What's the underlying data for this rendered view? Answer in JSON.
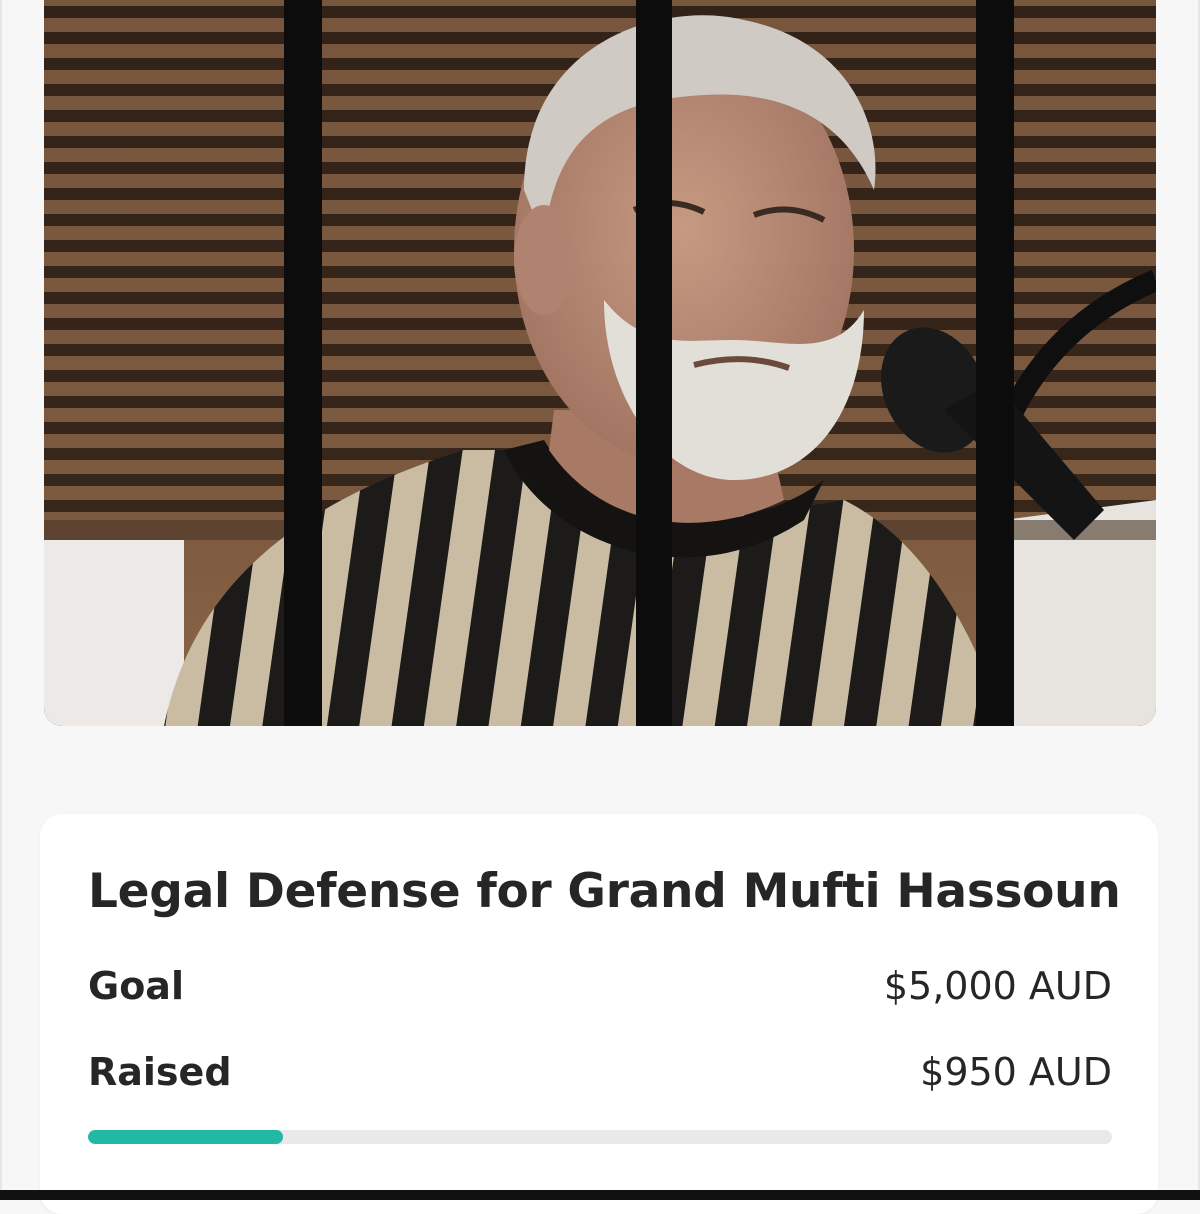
{
  "hero": {
    "alt": "Grand Mufti Hassoun behind bars"
  },
  "campaign": {
    "title": "Legal Defense for Grand Mufti Hassoun",
    "goal_label": "Goal",
    "goal_value": "$5,000 AUD",
    "raised_label": "Raised",
    "raised_value": "$950 AUD",
    "progress_fraction": 0.19
  },
  "colors": {
    "accent": "#22b8a6",
    "track": "#e9e8ea",
    "text": "#262626",
    "background": "#f7f7f8"
  }
}
